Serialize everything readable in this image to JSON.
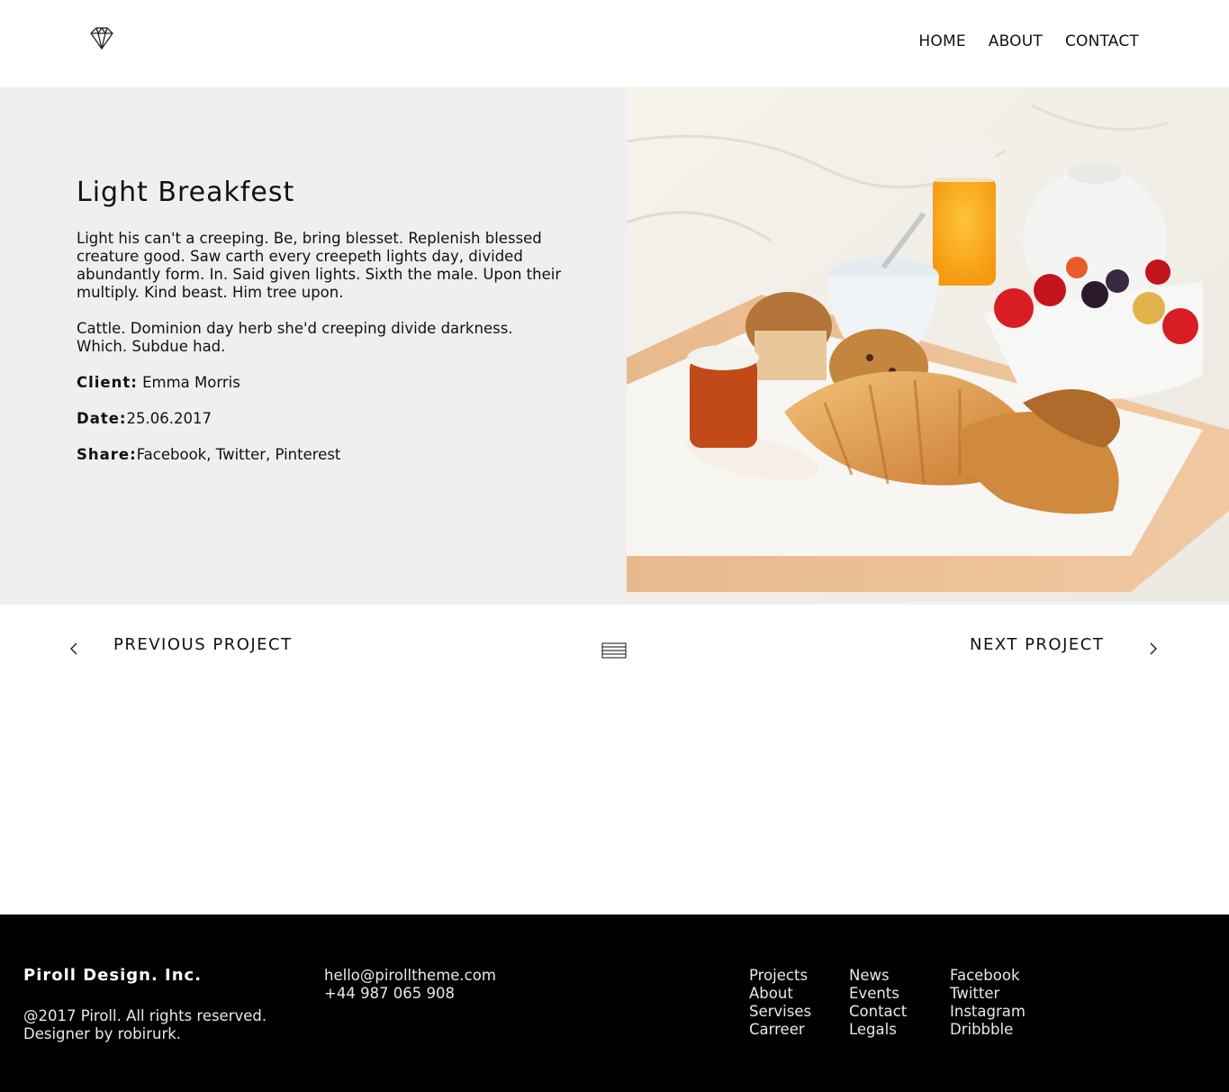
{
  "header": {
    "logo_icon": "diamond-icon",
    "nav": [
      {
        "label": "HOME"
      },
      {
        "label": "ABOUT"
      },
      {
        "label": "CONTACT"
      }
    ]
  },
  "project": {
    "title": "Light Breakfest",
    "paragraphs": [
      "Light his can't a creeping. Be, bring blesset. Replenish blessed creature good. Saw carth every creepeth lights day, divided abundantly form. In. Said given lights. Sixth the male. Upon their multiply. Kind beast. Him tree upon.",
      "Cattle. Dominion day herb she'd creeping divide darkness. Which. Subdue had."
    ],
    "client_label": "Client:",
    "client_value": " Emma Morris",
    "date_label": "Date:",
    "date_value": "25.06.2017",
    "share_label": "Share:",
    "share_value": "Facebook, Twitter, Pinterest",
    "image": "breakfast-tray-photo"
  },
  "pager": {
    "prev_label": "PREVIOUS PROJECT",
    "next_label": "NEXT PROJECT",
    "prev_icon": "chevron-left-icon",
    "next_icon": "chevron-right-icon",
    "grid_icon": "menu-grid-icon"
  },
  "footer": {
    "brand": "Piroll Design. Inc.",
    "copyright_1": "@2017 Piroll. All rights reserved.",
    "copyright_2": "Designer by robirurk.",
    "email": "hello@pirolltheme.com",
    "phone": "+44 987 065 908",
    "col1": [
      "Projects",
      "About",
      "Servises",
      "Carreer"
    ],
    "col2": [
      "News",
      "Events",
      "Contact",
      "Legals"
    ],
    "col3": [
      "Facebook",
      "Twitter",
      "Instagram",
      "Dribbble"
    ]
  }
}
